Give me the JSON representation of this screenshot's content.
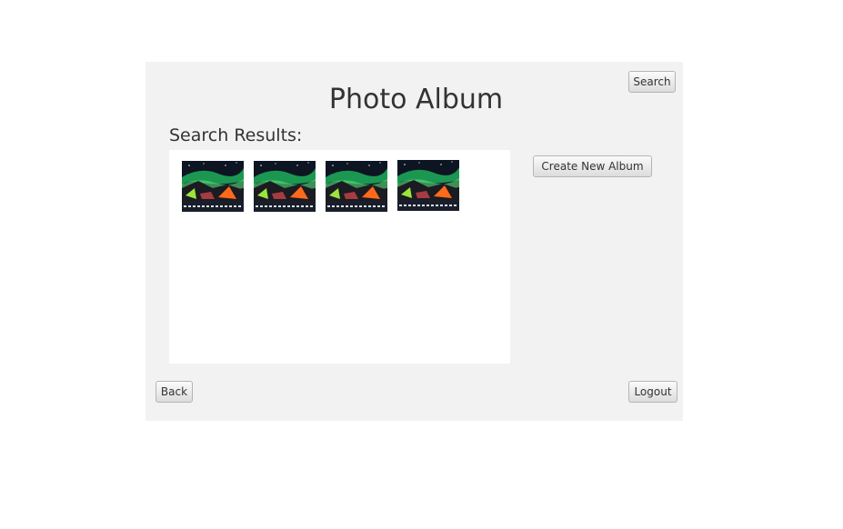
{
  "header": {
    "title": "Photo Album",
    "search_label": "Search"
  },
  "results": {
    "heading": "Search Results:",
    "photos": [
      {
        "icon": "aurora-photo"
      },
      {
        "icon": "aurora-photo"
      },
      {
        "icon": "aurora-photo"
      },
      {
        "icon": "aurora-photo"
      }
    ]
  },
  "actions": {
    "create_album_label": "Create New Album",
    "back_label": "Back",
    "logout_label": "Logout"
  },
  "colors": {
    "panel_bg": "#f2f2f2",
    "results_bg": "#ffffff",
    "text": "#333333"
  }
}
